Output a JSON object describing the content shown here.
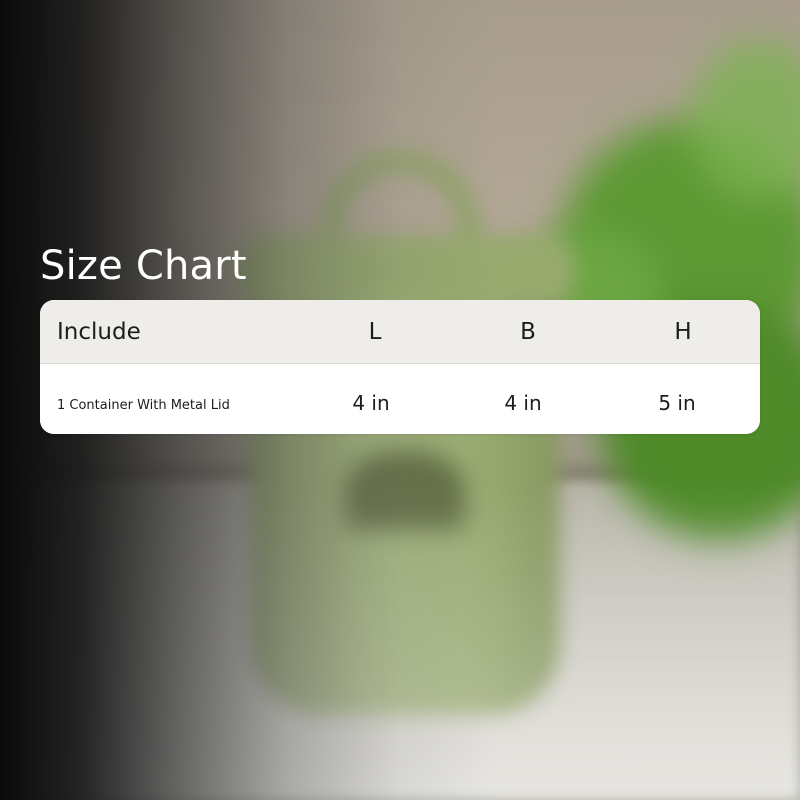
{
  "title": "Size Chart",
  "table": {
    "headers": {
      "include": "Include",
      "length": "L",
      "breadth": "B",
      "height": "H"
    },
    "rows": [
      {
        "include": "1 Container With Metal Lid",
        "length": "4 in",
        "breadth": "4 in",
        "height": "5 in"
      }
    ]
  },
  "colors": {
    "title_text": "#ffffff",
    "card_background": "#ffffff",
    "header_background": "#efede9",
    "cell_text": "#1d1d1d"
  }
}
